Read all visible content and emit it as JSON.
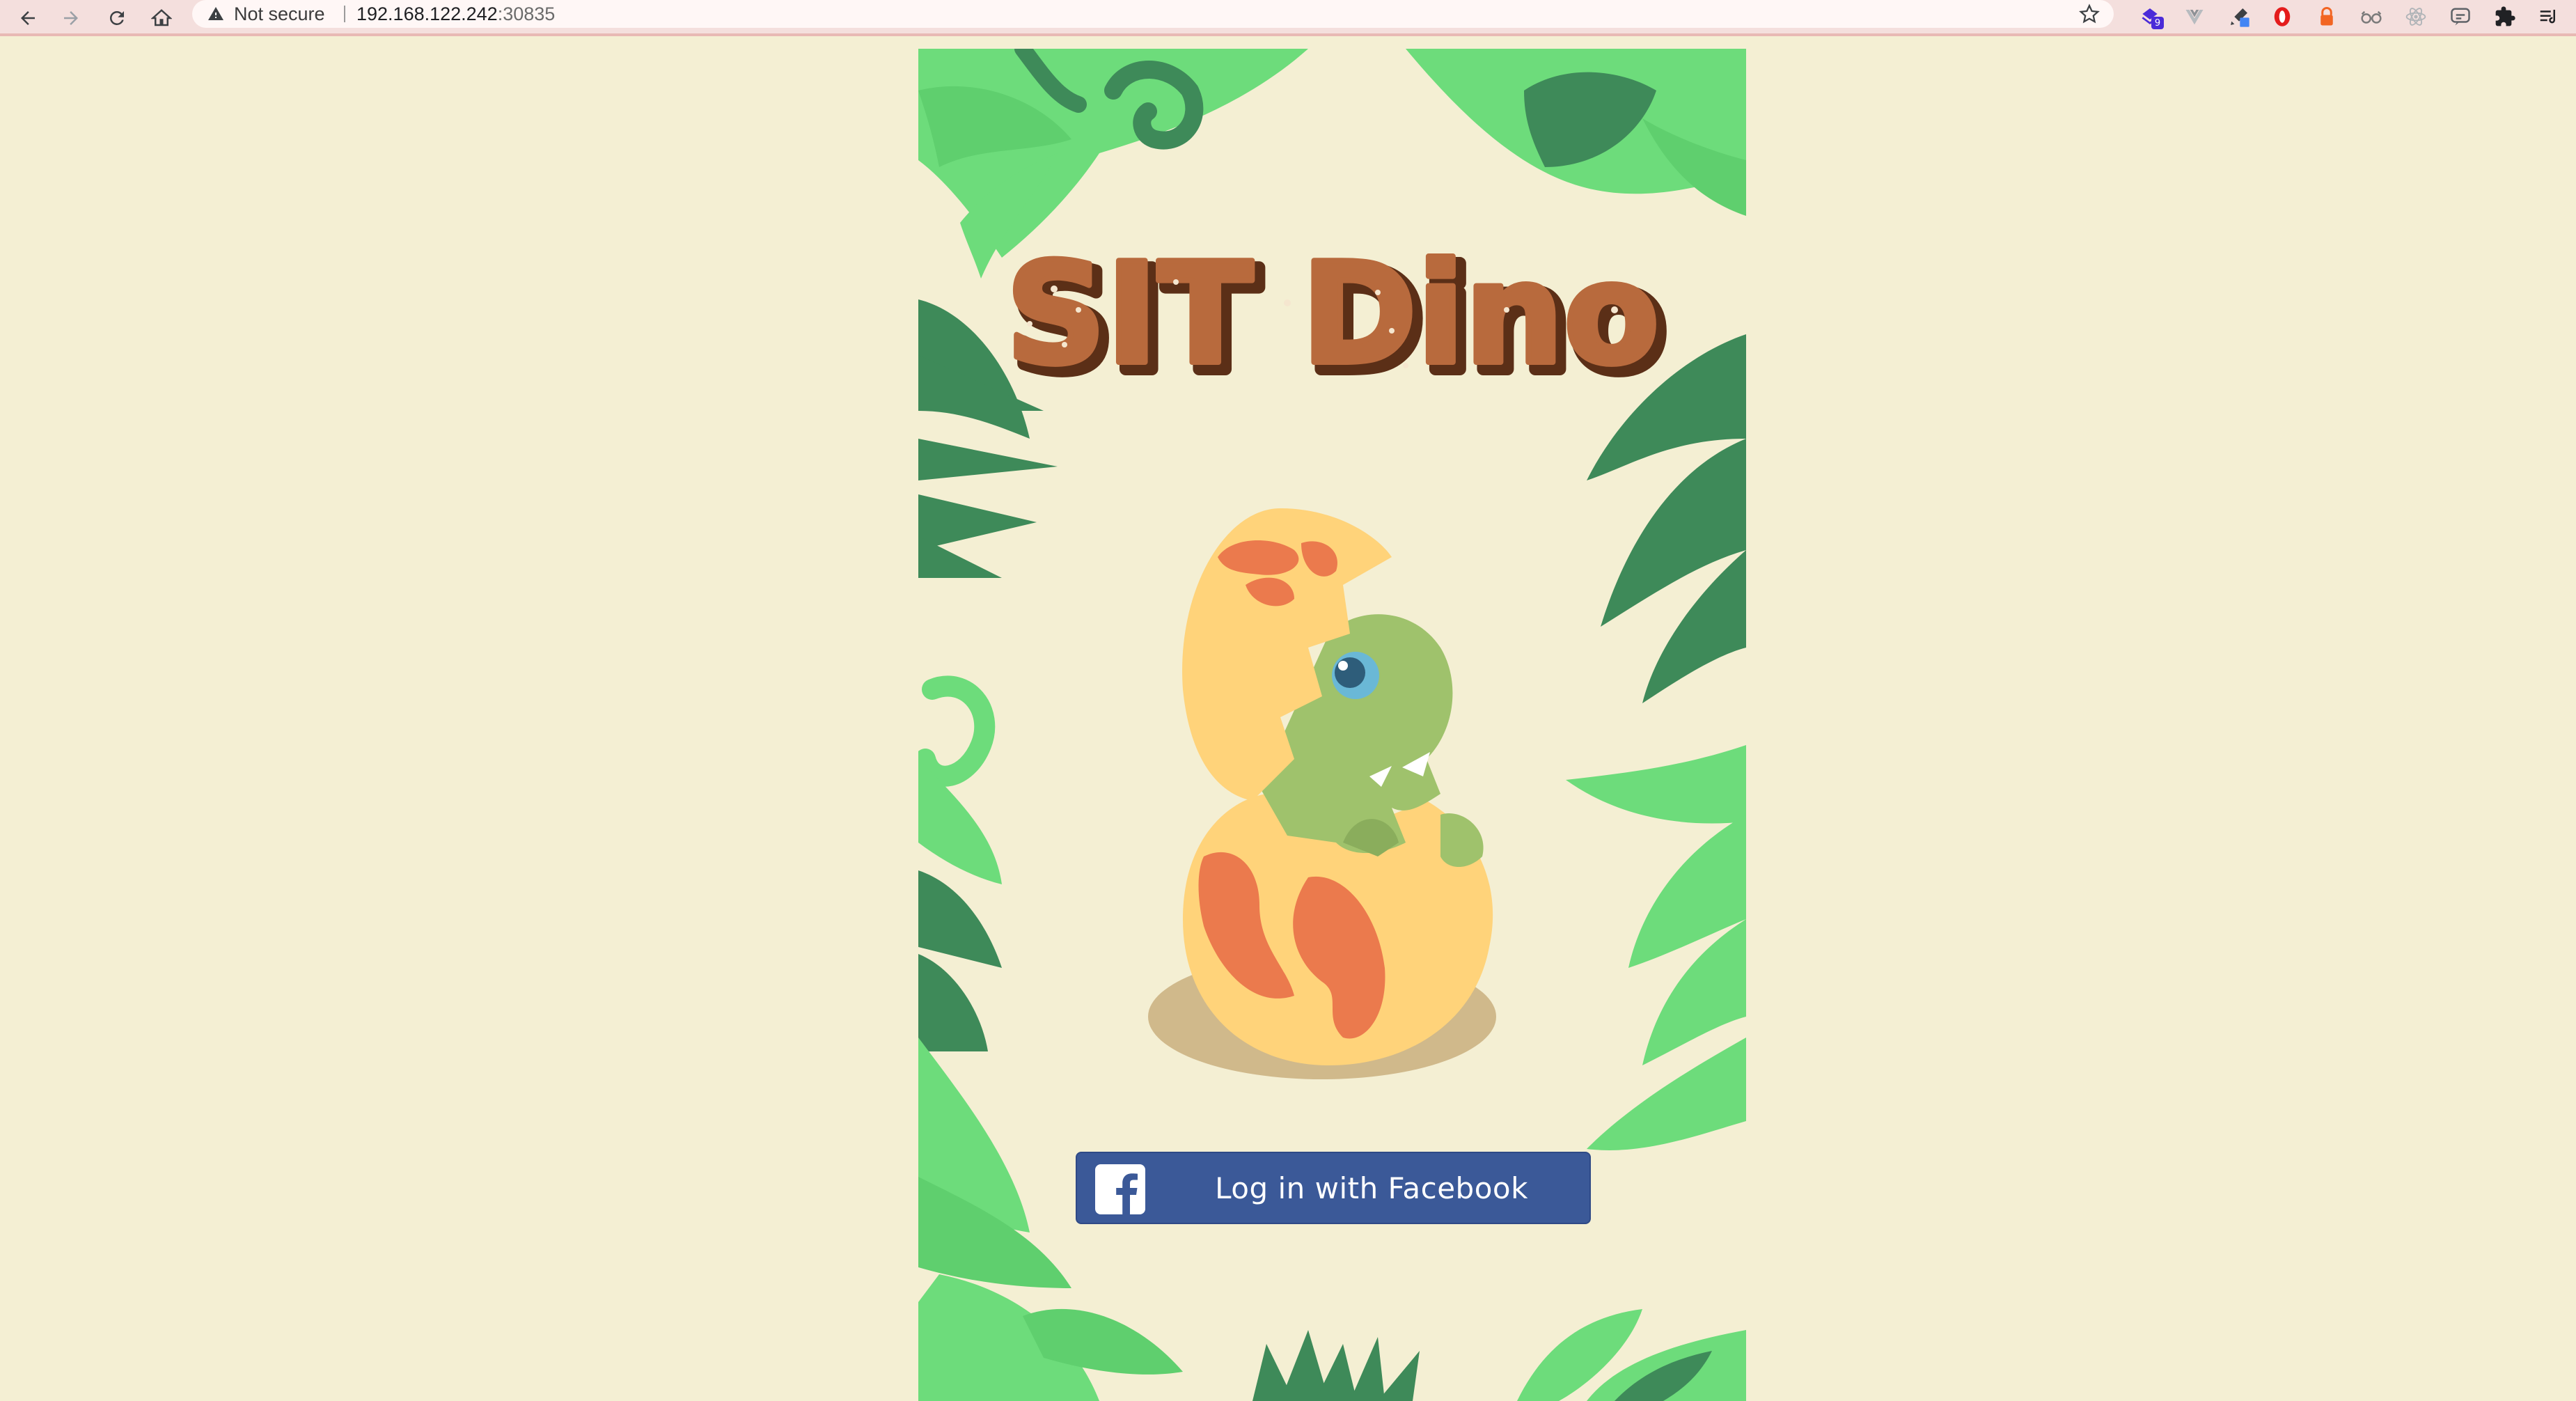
{
  "browser": {
    "security_label": "Not secure",
    "url_host": "192.168.122.242",
    "url_port": ":30835",
    "icons": [
      "back-icon",
      "forward-icon",
      "reload-icon",
      "home-icon",
      "warning-icon",
      "bookmark-star-icon",
      "extensions-puzzle-icon",
      "reading-list-icon"
    ],
    "extensions": [
      {
        "name": "extension-purple",
        "color": "#4a2bd8",
        "badge": "9"
      },
      {
        "name": "extension-vuejs",
        "color": "#9aa0a6"
      },
      {
        "name": "extension-color-picker",
        "color": "#4285f4"
      },
      {
        "name": "extension-red-shield",
        "color": "#e41c1c"
      },
      {
        "name": "extension-orange-lock",
        "color": "#f26522"
      },
      {
        "name": "extension-glasses",
        "color": "#7a7a7a"
      },
      {
        "name": "extension-react",
        "color": "#9aa0a6"
      },
      {
        "name": "extension-chat",
        "color": "#5f6368"
      }
    ]
  },
  "app": {
    "logo_text": "SIT Dino",
    "login_button_label": "Log in with Facebook",
    "colors": {
      "background": "#f4efd3",
      "facebook_blue": "#3b5998",
      "leaf_light": "#6ddc7b",
      "leaf_dark": "#3e8a59",
      "logo_brown": "#b86a3d"
    }
  }
}
